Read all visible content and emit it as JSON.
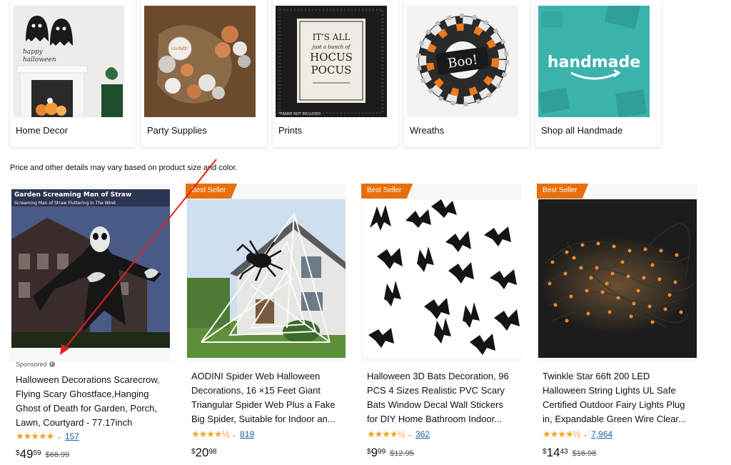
{
  "categories": [
    {
      "label": "Home Decor",
      "icon": "home-decor-image",
      "art_text_1": "happy",
      "art_text_2": "halloween"
    },
    {
      "label": "Party Supplies",
      "icon": "party-supplies-image",
      "art_text_1": "confetti"
    },
    {
      "label": "Prints",
      "icon": "prints-image",
      "art_text_1": "IT'S ALL",
      "art_text_2": "just a bunch of",
      "art_text_3": "HOCUS",
      "art_text_4": "POCUS",
      "art_text_5": "*FRAME NOT INCLUDED"
    },
    {
      "label": "Wreaths",
      "icon": "wreath-image",
      "art_text_1": "Boo!"
    },
    {
      "label": "Shop all Handmade",
      "icon": "handmade-image",
      "art_text_1": "handmade"
    }
  ],
  "notice": "Price and other details may vary based on product size and color.",
  "products": [
    {
      "image_text_1": "Garden Screaming Man of Straw",
      "image_text_2": "Screaming Man of Straw Fluttering In The Wind",
      "badge": "",
      "sponsored": "Sponsored",
      "title_lines": [
        "Halloween Decorations Scarecrow,",
        "Flying Scary Ghostface,Hanging",
        "Ghost of Death for Garden, Porch,",
        "Lawn, Courtyard - 77.17inch"
      ],
      "rating": 5.0,
      "stars": "★★★★★",
      "review_count": "157",
      "price_symbol": "$",
      "price_whole": "49",
      "price_fraction": "59",
      "list_price": "$66.99"
    },
    {
      "badge": "Best Seller",
      "title_lines": [
        "AODINI Spider Web Halloween",
        "Decorations, 16 ×15 Feet Giant",
        "Triangular Spider Web Plus a Fake",
        "Big Spider, Suitable for Indoor an..."
      ],
      "rating": 4.5,
      "stars": "★★★★½",
      "review_count": "819",
      "price_symbol": "$",
      "price_whole": "20",
      "price_fraction": "98",
      "list_price": ""
    },
    {
      "badge": "Best Seller",
      "title_lines": [
        "Halloween 3D Bats Decoration, 96",
        "PCS 4 Sizes Realistic PVC Scary",
        "Bats Window Decal Wall Stickers",
        "for DIY Home Bathroom Indoor..."
      ],
      "rating": 4.5,
      "stars": "★★★★½",
      "review_count": "362",
      "price_symbol": "$",
      "price_whole": "9",
      "price_fraction": "99",
      "list_price": "$12.95"
    },
    {
      "badge": "Best Seller",
      "title_lines": [
        "Twinkle Star 66ft 200 LED",
        "Halloween String Lights UL Safe",
        "Certified Outdoor Fairy Lights Plug",
        "in, Expandable Green Wire Clear..."
      ],
      "rating": 4.5,
      "stars": "★★★★½",
      "review_count": "7,964",
      "price_symbol": "$",
      "price_whole": "14",
      "price_fraction": "43",
      "list_price": "$16.98"
    }
  ],
  "colors": {
    "badge": "#e8700c",
    "star": "#f7a21b",
    "link": "#2162a1",
    "annotation_arrow": "#e0201c"
  },
  "annotation": {
    "type": "arrow",
    "icon": "red-arrow-annotation"
  }
}
